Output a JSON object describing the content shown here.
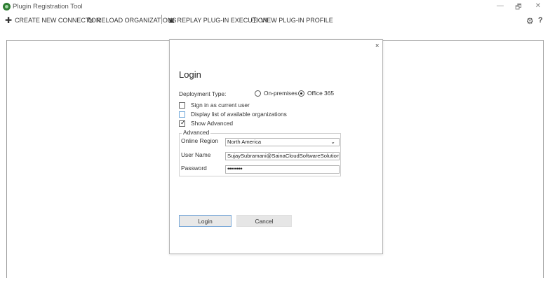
{
  "window": {
    "title": "Plugin Registration Tool",
    "minimize_glyph": "—",
    "maximize_glyph": "🗗",
    "close_glyph": "✕"
  },
  "toolbar": {
    "create_connection": {
      "label": "CREATE NEW CONNECTION",
      "icon": "plus-icon",
      "glyph": "✚"
    },
    "reload_orgs": {
      "label": "RELOAD ORGANIZATIONS",
      "icon": "reload-icon",
      "glyph": "↻"
    },
    "replay_execution": {
      "label": "REPLAY PLUG-IN EXECUTION",
      "icon": "replay-icon",
      "glyph": "▣"
    },
    "view_profile": {
      "label": "VIEW PLUG-IN PROFILE",
      "icon": "profile-icon",
      "glyph": "⚇"
    },
    "settings_glyph": "⚙",
    "help_glyph": "?"
  },
  "dialog": {
    "close_glyph": "×",
    "title": "Login",
    "deployment_type_label": "Deployment Type:",
    "deployment_options": [
      {
        "label": "On-premises",
        "selected": false
      },
      {
        "label": "Office 365",
        "selected": true
      }
    ],
    "checkboxes": [
      {
        "label": "Sign in as current user",
        "checked": false
      },
      {
        "label": "Display list of available organizations",
        "checked": false
      },
      {
        "label": "Show Advanced",
        "checked": true
      }
    ],
    "advanced": {
      "legend": "Advanced",
      "online_region_label": "Online Region",
      "online_region_value": "North America",
      "user_name_label": "User Name",
      "user_name_value": "SujaySubramani@SainaCloudSoftwareSolutions.c",
      "password_label": "Password",
      "password_value": "••••••••"
    },
    "login_button": "Login",
    "cancel_button": "Cancel"
  }
}
